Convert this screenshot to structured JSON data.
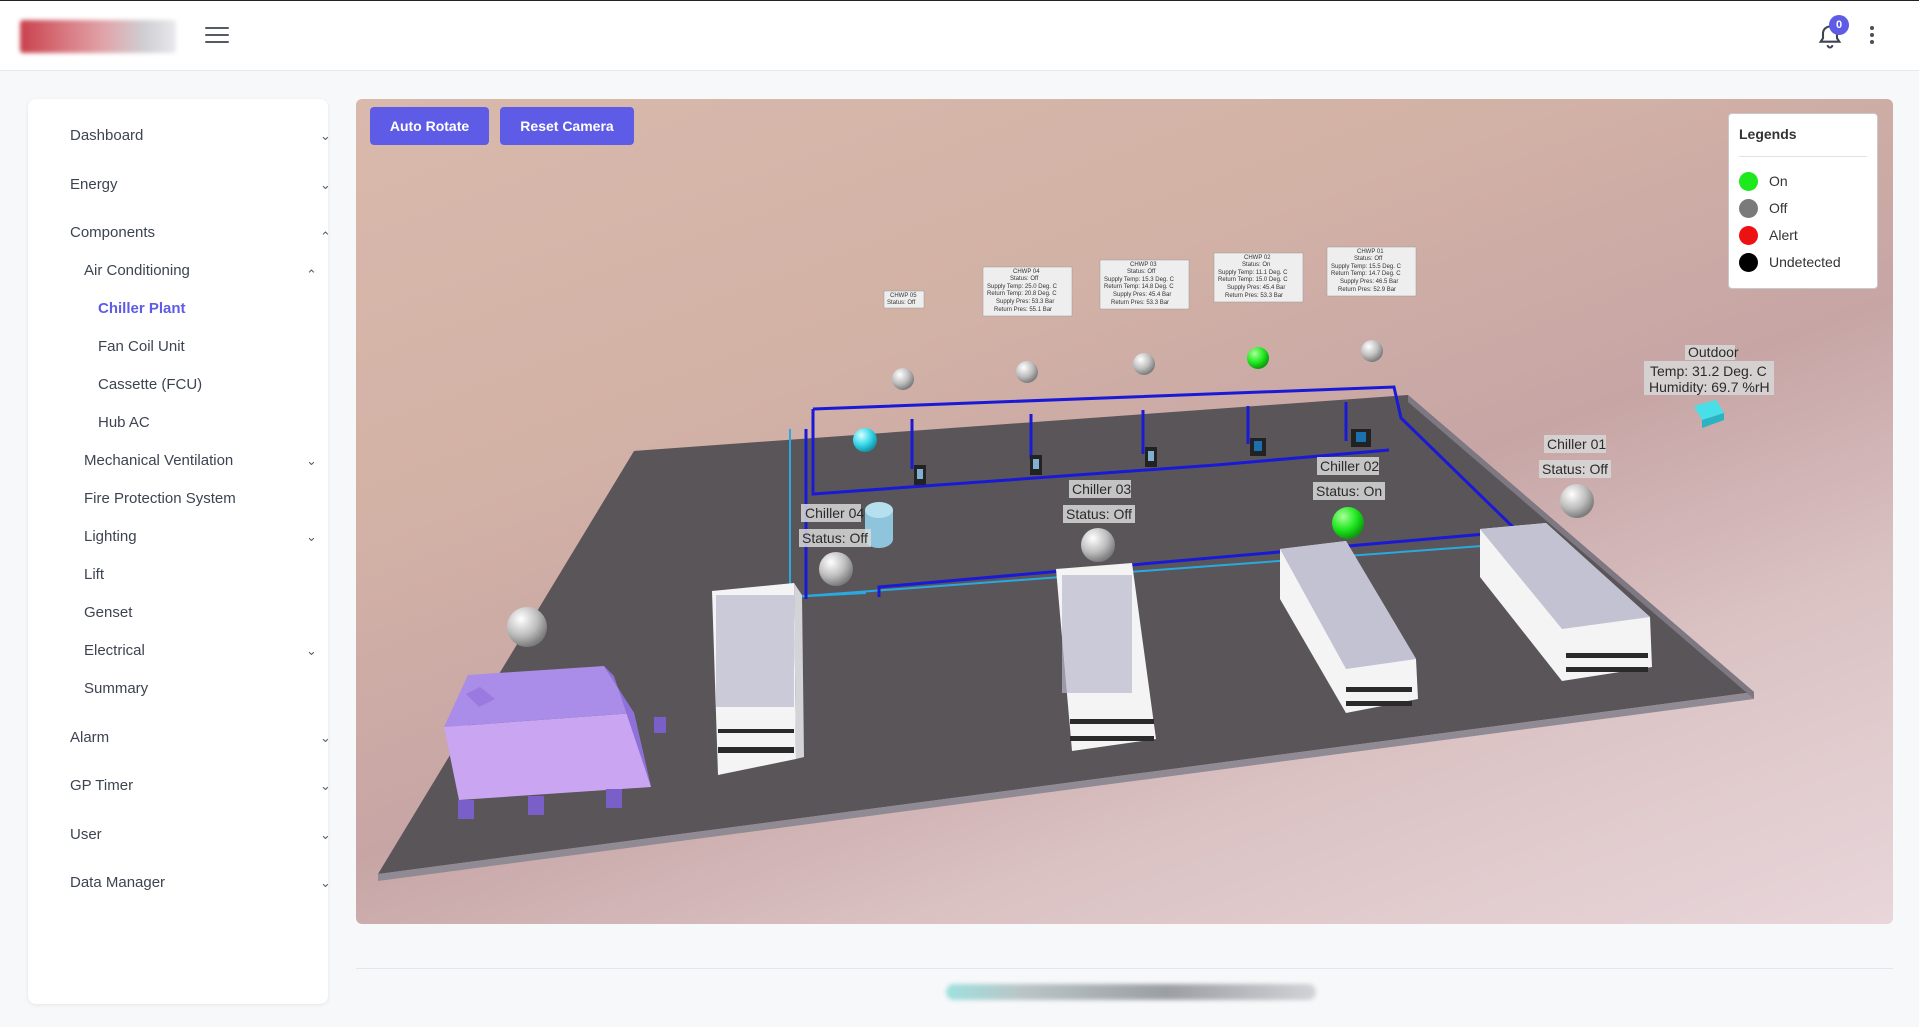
{
  "header": {
    "notifications_count": "0"
  },
  "sidebar": {
    "items": [
      {
        "label": "Dashboard"
      },
      {
        "label": "Energy"
      },
      {
        "label": "Components"
      },
      {
        "label": "Air Conditioning"
      },
      {
        "label": "Chiller Plant"
      },
      {
        "label": "Fan Coil Unit"
      },
      {
        "label": "Cassette (FCU)"
      },
      {
        "label": "Hub AC"
      },
      {
        "label": "Mechanical Ventilation"
      },
      {
        "label": "Fire Protection System"
      },
      {
        "label": "Lighting"
      },
      {
        "label": "Lift"
      },
      {
        "label": "Genset"
      },
      {
        "label": "Electrical"
      },
      {
        "label": "Summary"
      },
      {
        "label": "Alarm"
      },
      {
        "label": "GP Timer"
      },
      {
        "label": "User"
      },
      {
        "label": "Data Manager"
      }
    ],
    "active": "Chiller Plant"
  },
  "viewer": {
    "auto_rotate_label": "Auto Rotate",
    "reset_camera_label": "Reset Camera",
    "legend": {
      "title": "Legends",
      "items": [
        {
          "label": "On",
          "color": "#1ee81e"
        },
        {
          "label": "Off",
          "color": "#7a7a7a"
        },
        {
          "label": "Alert",
          "color": "#ee1111"
        },
        {
          "label": "Undetected",
          "color": "#000000"
        }
      ]
    },
    "chillers": [
      {
        "name": "Chiller 04",
        "status": "Status: Off"
      },
      {
        "name": "Chiller 03",
        "status": "Status: Off"
      },
      {
        "name": "Chiller 02",
        "status": "Status: On"
      },
      {
        "name": "Chiller 01",
        "status": "Status: Off"
      }
    ],
    "outdoor": {
      "title": "Outdoor",
      "temp": "Temp: 31.2 Deg. C",
      "humidity": "Humidity: 69.7 %rH"
    },
    "pumps": [
      {
        "lines": [
          "CHWP 05",
          "Status: Off"
        ]
      },
      {
        "lines": [
          "CHWP 04",
          "Status: Off",
          "Supply Temp: 25.0 Deg. C",
          "Return Temp: 20.8 Deg. C",
          "Supply Pres: 53.3 Bar",
          "Return Pres: 55.1 Bar"
        ]
      },
      {
        "lines": [
          "CHWP 03",
          "Status: Off",
          "Supply Temp: 15.3 Deg. C",
          "Return Temp: 14.8 Deg. C",
          "Supply Pres: 45.4 Bar",
          "Return Pres: 53.3 Bar"
        ]
      },
      {
        "lines": [
          "CHWP 02",
          "Status: On",
          "Supply Temp: 11.1 Deg. C",
          "Return Temp: 15.0 Deg. C",
          "Supply Pres: 45.4 Bar",
          "Return Pres: 53.3 Bar"
        ]
      },
      {
        "lines": [
          "CHWP 01",
          "Status: Off",
          "Supply Temp: 15.5 Deg. C",
          "Return Temp: 14.7 Deg. C",
          "Supply Pres: 46.5 Bar",
          "Return Pres: 52.9 Bar"
        ]
      }
    ],
    "colors": {
      "accent": "#5e5ce6",
      "pipe_supply": "#1a1ad6",
      "pipe_return": "#2aa8e0",
      "floor": "#5a5559",
      "cooling_tower": "#a98de8"
    }
  }
}
